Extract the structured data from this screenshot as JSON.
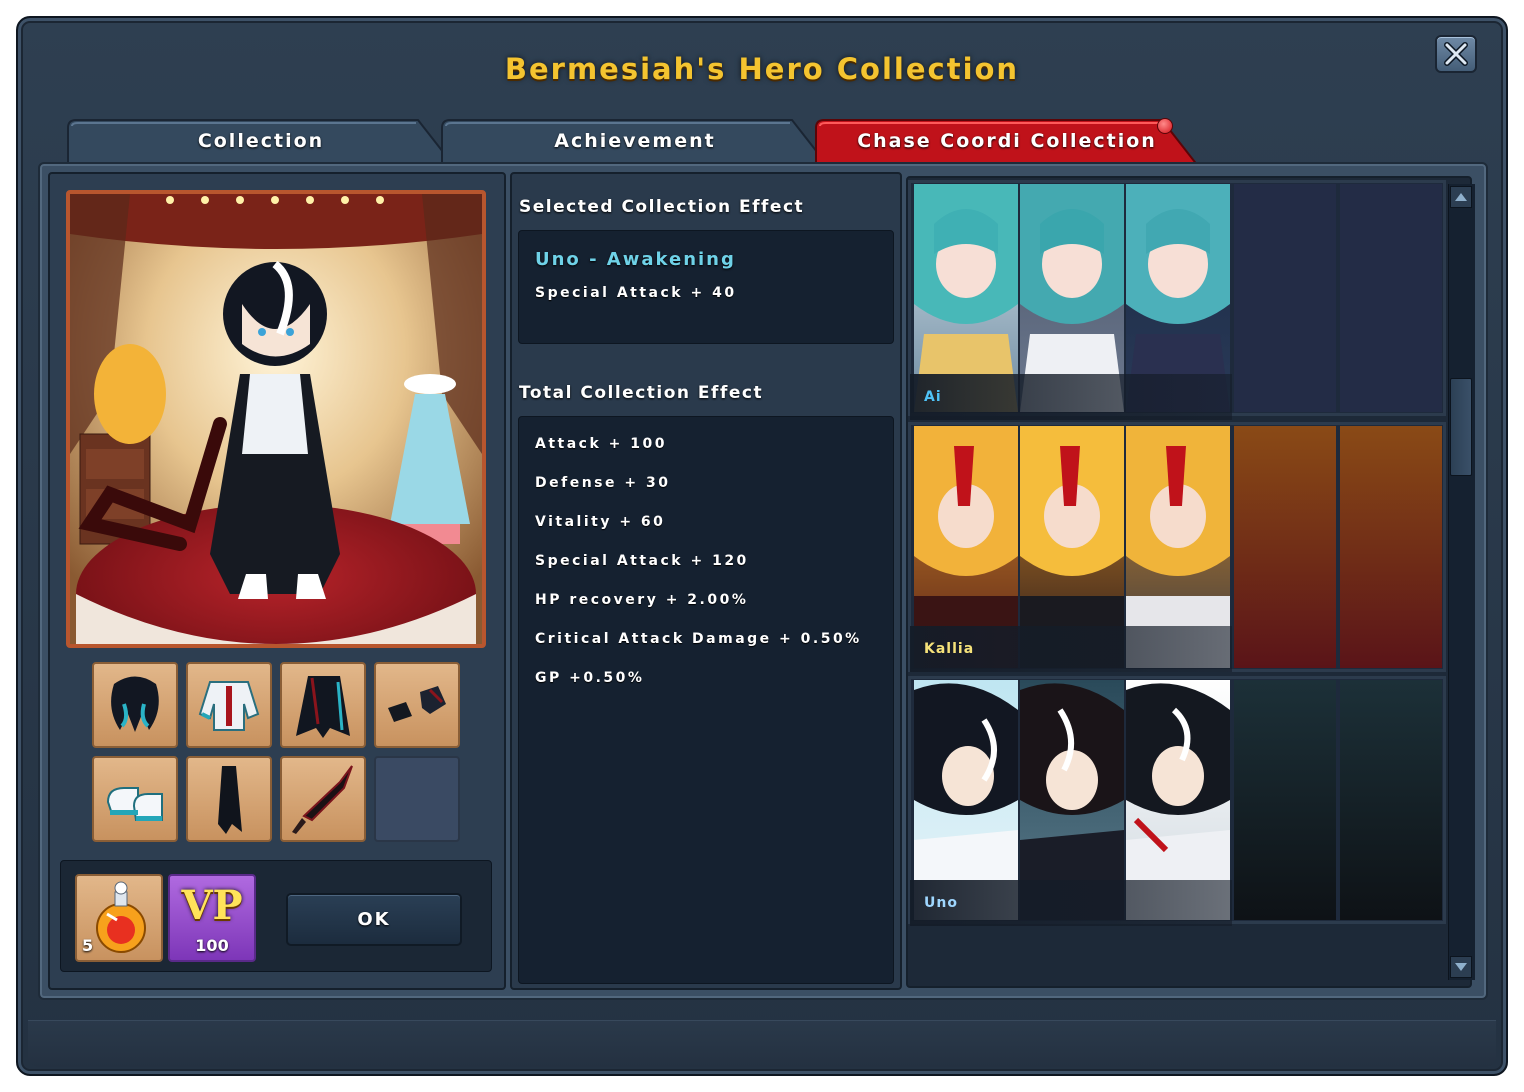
{
  "window": {
    "title": "Bermesiah's Hero Collection"
  },
  "tabs": [
    {
      "label": "Collection",
      "active": false
    },
    {
      "label": "Achievement",
      "active": false
    },
    {
      "label": "Chase Coordi Collection",
      "active": true
    }
  ],
  "selected_effect": {
    "heading": "Selected Collection Effect",
    "name": "Uno - Awakening",
    "stat": "Special Attack  +  40"
  },
  "total_effect": {
    "heading": "Total Collection Effect",
    "stats": [
      "Attack  +  100",
      "Defense  +  30",
      "Vitality  +  60",
      "Special Attack  +  120",
      "HP recovery  +  2.00%",
      "Critical Attack Damage  +  0.50%",
      "GP +0.50%"
    ]
  },
  "equipment_slots": [
    "hair-icon",
    "top-icon",
    "bottom-icon",
    "gloves-icon",
    "shoes-icon",
    "cape-icon",
    "weapon-icon",
    "empty"
  ],
  "currency": {
    "potion_count": "5",
    "vp_label": "VP",
    "vp_amount": "100"
  },
  "ok_label": "OK",
  "collections": [
    {
      "name": "Ai",
      "name_color": "#4fc3f7",
      "filled": 3,
      "total": 5
    },
    {
      "name": "Kallia",
      "name_color": "#f6e27a",
      "filled": 3,
      "total": 5
    },
    {
      "name": "Uno",
      "name_color": "#9fd7ff",
      "filled": 3,
      "total": 5
    }
  ],
  "colors": {
    "title": "#f4c430",
    "active_tab": "#c0121a",
    "effect_name": "#6fd2e8"
  }
}
